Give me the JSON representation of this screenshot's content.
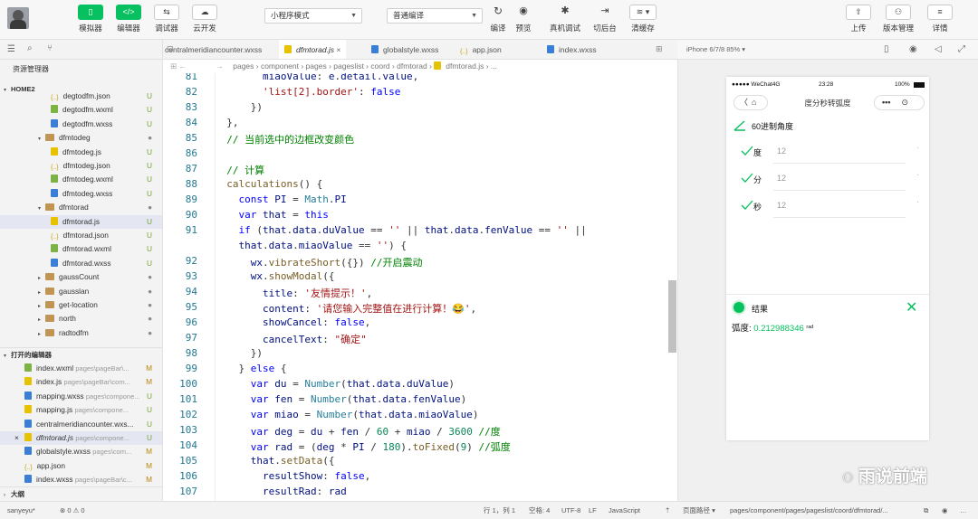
{
  "toolbar": {
    "simulator": "模拟器",
    "editor": "编辑器",
    "debugger": "调试器",
    "cloud": "云开发",
    "mode": "小程序模式",
    "compile_mode": "普通编译",
    "compile": "编译",
    "preview": "预览",
    "real_debug": "真机调试",
    "background": "切后台",
    "clear_cache": "清缓存",
    "upload": "上传",
    "version": "版本管理",
    "details": "详情"
  },
  "explorer": {
    "title": "资源管理器",
    "root": "HOME2",
    "open_editors": "打开的编辑器",
    "outline": "大纲",
    "tree": [
      {
        "name": "degtodfm.json",
        "type": "json",
        "status": "U"
      },
      {
        "name": "degtodfm.wxml",
        "type": "wxml",
        "status": "U"
      },
      {
        "name": "degtodfm.wxss",
        "type": "wxss",
        "status": "U"
      },
      {
        "name": "dfmtodeg",
        "type": "folder",
        "status": "●"
      },
      {
        "name": "dfmtodeg.js",
        "type": "js",
        "status": "U"
      },
      {
        "name": "dfmtodeg.json",
        "type": "json",
        "status": "U"
      },
      {
        "name": "dfmtodeg.wxml",
        "type": "wxml",
        "status": "U"
      },
      {
        "name": "dfmtodeg.wxss",
        "type": "wxss",
        "status": "U"
      },
      {
        "name": "dfmtorad",
        "type": "folder",
        "status": "●"
      },
      {
        "name": "dfmtorad.js",
        "type": "js",
        "status": "U"
      },
      {
        "name": "dfmtorad.json",
        "type": "json",
        "status": "U"
      },
      {
        "name": "dfmtorad.wxml",
        "type": "wxml",
        "status": "U"
      },
      {
        "name": "dfmtorad.wxss",
        "type": "wxss",
        "status": "U"
      },
      {
        "name": "gaussCount",
        "type": "folder",
        "status": "●"
      },
      {
        "name": "gausslan",
        "type": "folder",
        "status": "●"
      },
      {
        "name": "get-location",
        "type": "folder",
        "status": "●"
      },
      {
        "name": "north",
        "type": "folder",
        "status": "●"
      },
      {
        "name": "radtodfm",
        "type": "folder",
        "status": "●"
      }
    ],
    "opened": [
      {
        "name": "index.wxml",
        "path": "pages\\pageBar\\...",
        "type": "wxml",
        "status": "M"
      },
      {
        "name": "index.js",
        "path": "pages\\pageBar\\com...",
        "type": "js",
        "status": "M"
      },
      {
        "name": "mapping.wxss",
        "path": "pages\\compone...",
        "type": "wxss",
        "status": "U"
      },
      {
        "name": "mapping.js",
        "path": "pages\\compone...",
        "type": "js",
        "status": "U"
      },
      {
        "name": "centralmeridiancounter.wxs...",
        "path": "",
        "type": "wxss",
        "status": "U"
      },
      {
        "name": "dfmtorad.js",
        "path": "pages\\compone...",
        "type": "js",
        "status": "U"
      },
      {
        "name": "globalstyle.wxss",
        "path": "pages\\com...",
        "type": "wxss",
        "status": "M"
      },
      {
        "name": "app.json",
        "path": "",
        "type": "json",
        "status": "M"
      },
      {
        "name": "index.wxss",
        "path": "pages\\pageBar\\c...",
        "type": "wxss",
        "status": "M"
      }
    ]
  },
  "tabs": [
    "centralmeridiancounter.wxss",
    "dfmtorad.js",
    "globalstyle.wxss",
    "app.json",
    "index.wxss"
  ],
  "breadcrumb": "pages › component › pages › pageslist › coord › dfmtorad › ",
  "breadcrumb_file": "dfmtorad.js › ...",
  "code": {
    "line_numbers": [
      "81",
      "82",
      "83",
      "84",
      "85",
      "86",
      "87",
      "88",
      "89",
      "90",
      "91",
      "",
      "92",
      "93",
      "94",
      "95",
      "96",
      "97",
      "98",
      "99",
      "100",
      "101",
      "102",
      "103",
      "104",
      "105",
      "106",
      "107"
    ]
  },
  "simulator": {
    "device": "iPhone 6/7/8 85% ▾",
    "carrier": "●●●●● WeChat4G",
    "time": "23:28",
    "battery": "100%",
    "nav_title": "度分秒转弧度",
    "section_title": "60进制角度",
    "fields": [
      {
        "label": "度",
        "value": "12"
      },
      {
        "label": "分",
        "value": "12"
      },
      {
        "label": "秒",
        "value": "12"
      }
    ],
    "result_title": "结果",
    "result_label": "弧度:",
    "result_value": "0.212988346",
    "result_unit": "rad"
  },
  "watermark": "雨说前端",
  "statusbar": {
    "user": "sanyeyu*",
    "errors": "⊗ 0 ⚠ 0",
    "position": "行 1，列 1",
    "spaces": "空格: 4",
    "encoding": "UTF-8",
    "eol": "LF",
    "language": "JavaScript",
    "page_path_label": "页面路径 ▾",
    "page_path": "pages/component/pages/pageslist/coord/dfmtorad/..."
  },
  "colors": {
    "accent": "#07c160",
    "keyword": "#0000ff",
    "string": "#a31515",
    "comment": "#008000"
  }
}
